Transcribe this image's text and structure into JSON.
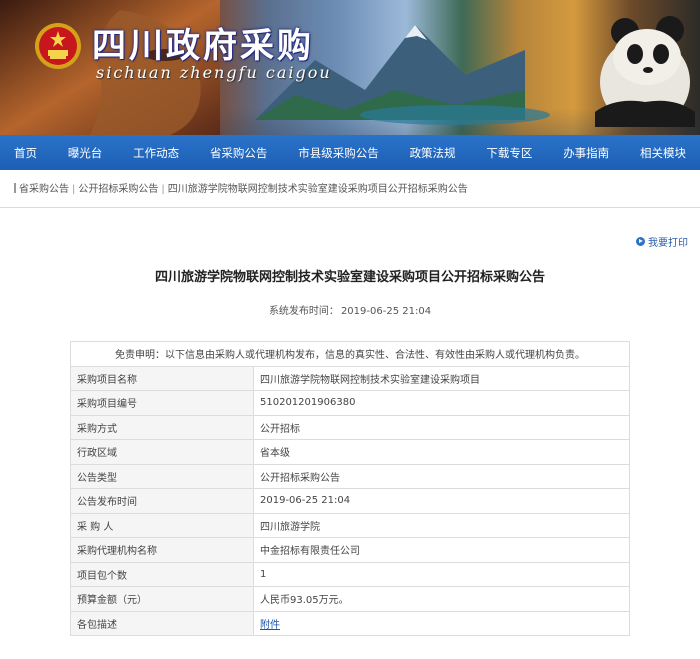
{
  "header": {
    "site_title": "四川政府采购",
    "site_pinyin": "sichuan  zhengfu  caigou"
  },
  "nav": {
    "items": [
      "首页",
      "曝光台",
      "工作动态",
      "省采购公告",
      "市县级采购公告",
      "政策法规",
      "下载专区",
      "办事指南",
      "相关模块"
    ]
  },
  "breadcrumb": {
    "items": [
      "省采购公告",
      "公开招标采购公告",
      "四川旅游学院物联网控制技术实验室建设采购项目公开招标采购公告"
    ],
    "separator": "|"
  },
  "print_label": "我要打印",
  "article": {
    "title": "四川旅游学院物联网控制技术实验室建设采购项目公开招标采购公告",
    "publish_time_label": "系统发布时间：",
    "publish_time": "2019-06-25 21:04"
  },
  "table": {
    "disclaimer": "免责申明：以下信息由采购人或代理机构发布，信息的真实性、合法性、有效性由采购人或代理机构负责。",
    "rows": [
      {
        "label": "采购项目名称",
        "value": "四川旅游学院物联网控制技术实验室建设采购项目"
      },
      {
        "label": "采购项目编号",
        "value": "510201201906380"
      },
      {
        "label": "采购方式",
        "value": "公开招标"
      },
      {
        "label": "行政区域",
        "value": "省本级"
      },
      {
        "label": "公告类型",
        "value": "公开招标采购公告"
      },
      {
        "label": "公告发布时间",
        "value": "2019-06-25 21:04"
      },
      {
        "label": "采 购 人",
        "value": "四川旅游学院"
      },
      {
        "label": "采购代理机构名称",
        "value": "中金招标有限责任公司"
      },
      {
        "label": "项目包个数",
        "value": "1"
      },
      {
        "label": "预算金额（元）",
        "value": "人民币93.05万元。"
      },
      {
        "label": "各包描述",
        "value": "附件"
      }
    ]
  },
  "colors": {
    "nav_bg": "#1d5fb4",
    "link": "#1a55b0"
  }
}
